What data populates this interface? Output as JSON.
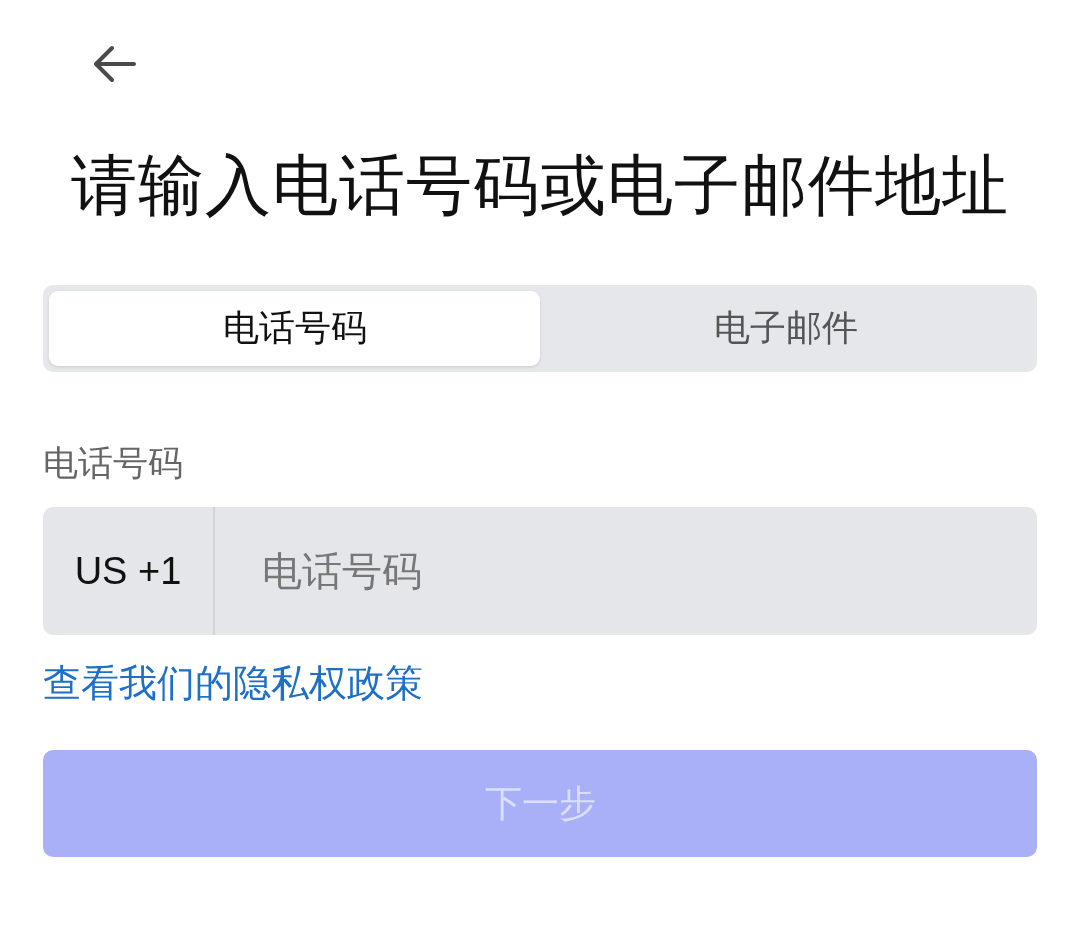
{
  "title": "请输入电话号码或电子邮件地址",
  "tabs": [
    {
      "label": "电话号码",
      "selected": true
    },
    {
      "label": "电子邮件",
      "selected": false
    }
  ],
  "phone_field": {
    "label": "电话号码",
    "country_code": "US +1",
    "placeholder": "电话号码"
  },
  "privacy_link": "查看我们的隐私权政策",
  "next_button": {
    "label": "下一步",
    "disabled": true
  }
}
